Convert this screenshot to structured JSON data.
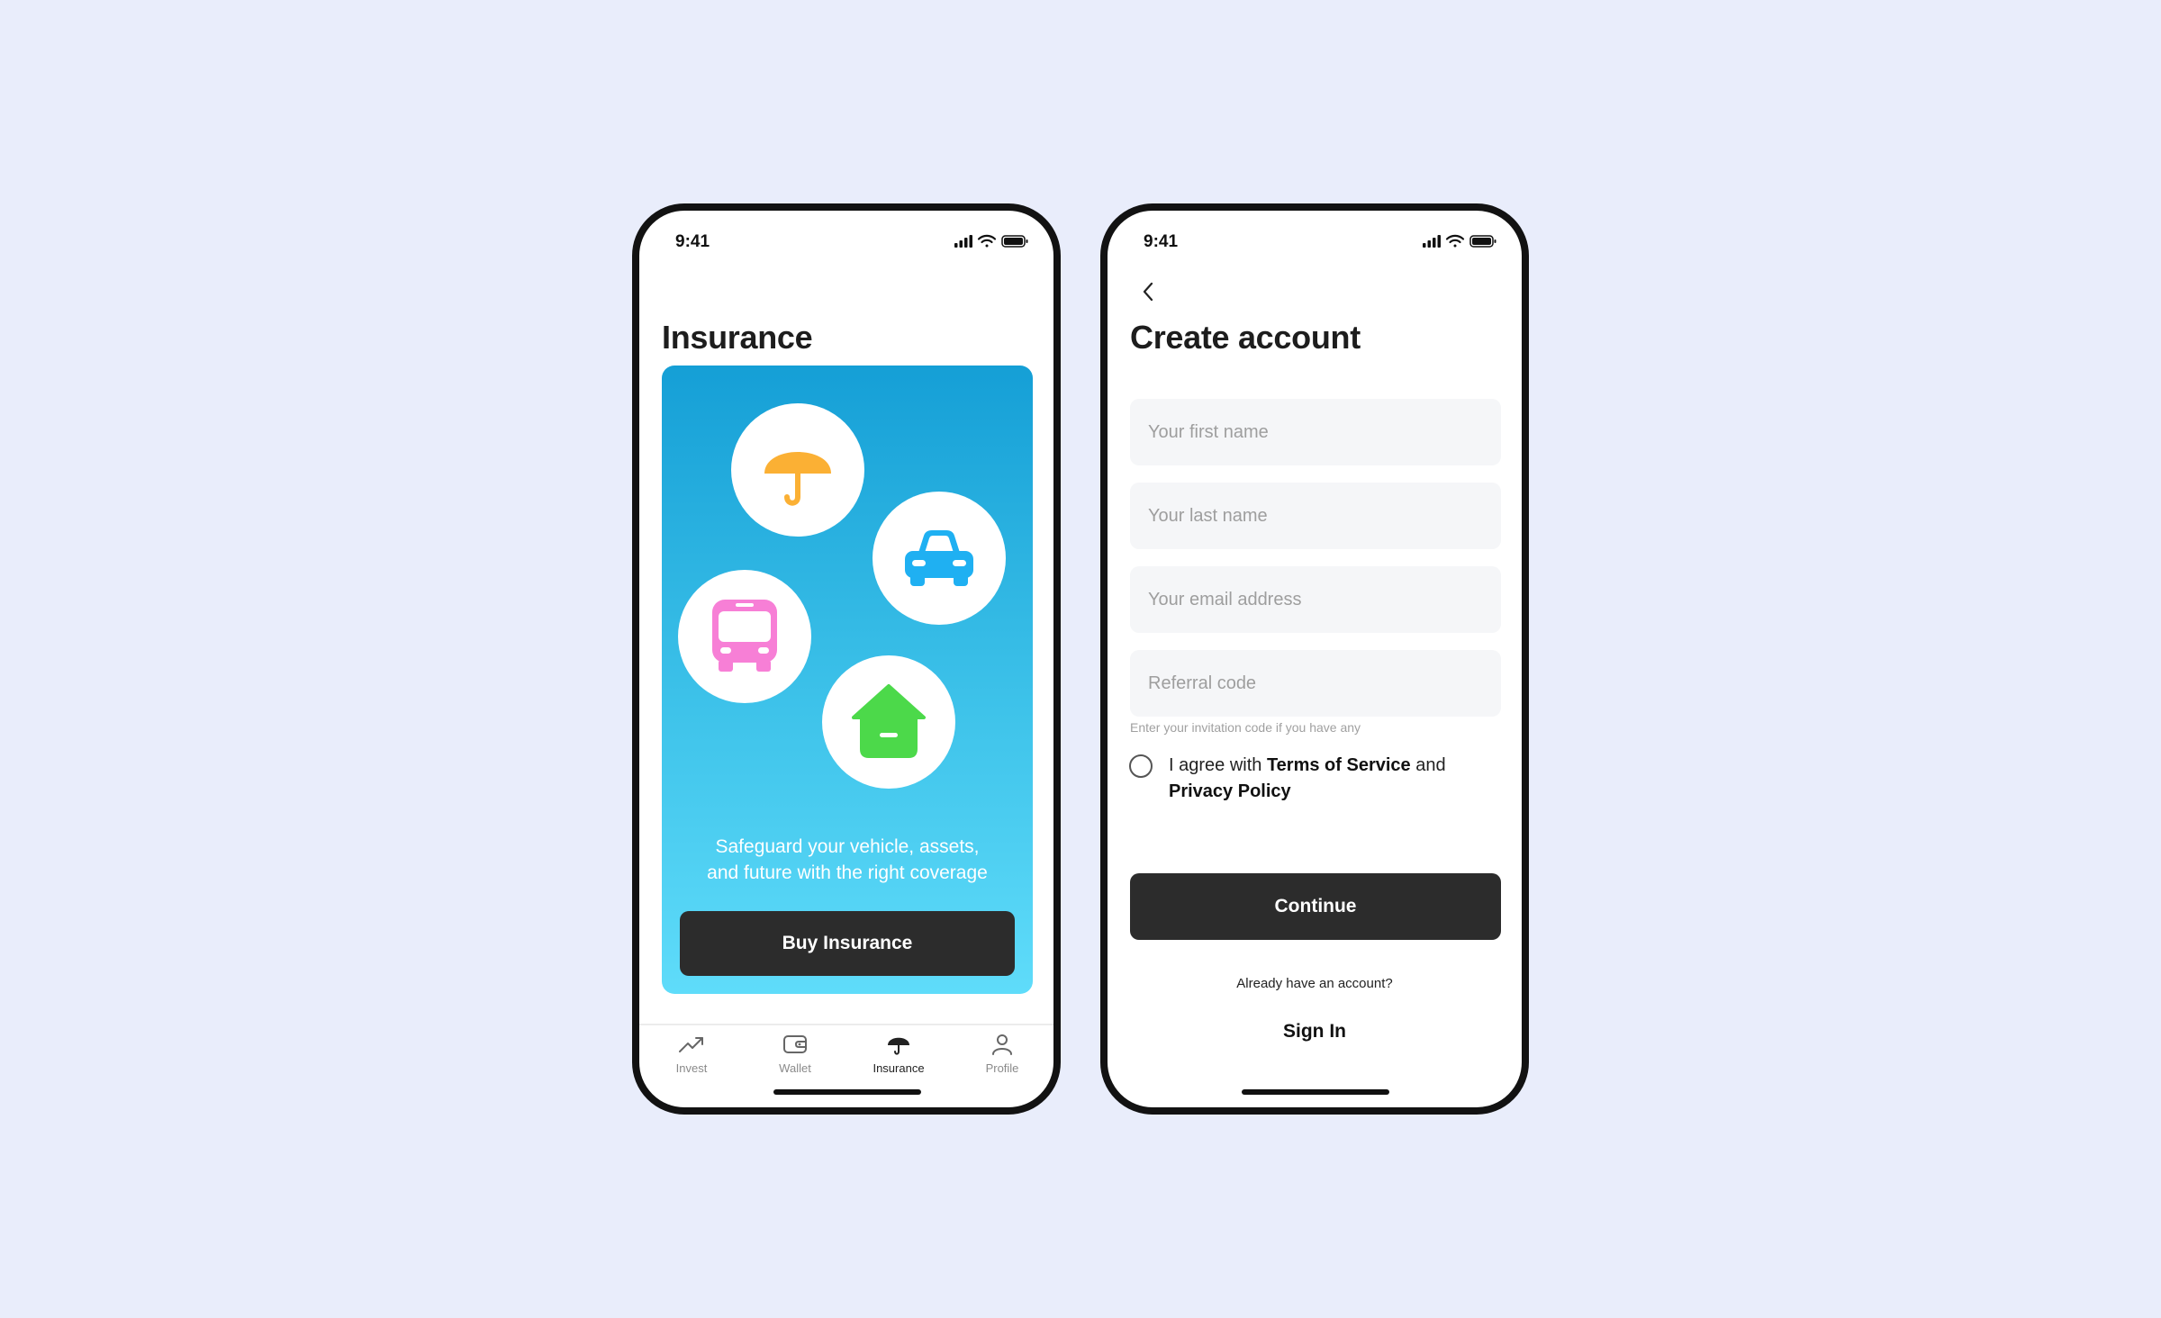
{
  "status_bar": {
    "time": "9:41"
  },
  "insurance_screen": {
    "title": "Insurance",
    "hero_icons": [
      "umbrella-icon",
      "car-icon",
      "bus-icon",
      "house-icon"
    ],
    "tagline_line1": "Safeguard your vehicle, assets,",
    "tagline_line2": "and future with the right coverage",
    "buy_button_label": "Buy Insurance",
    "tabs": [
      {
        "label": "Invest",
        "icon": "trending-up-icon",
        "active": false
      },
      {
        "label": "Wallet",
        "icon": "wallet-icon",
        "active": false
      },
      {
        "label": "Insurance",
        "icon": "umbrella-icon",
        "active": true
      },
      {
        "label": "Profile",
        "icon": "user-icon",
        "active": false
      }
    ]
  },
  "create_account_screen": {
    "title": "Create account",
    "first_name_placeholder": "Your first name",
    "last_name_placeholder": "Your last name",
    "email_placeholder": "Your email address",
    "referral_placeholder": "Referral code",
    "referral_helper": "Enter your invitation code if you have any",
    "agree_prefix": "I agree with ",
    "terms_link": "Terms of Service",
    "agree_middle": " and",
    "privacy_link": "Privacy Policy",
    "continue_label": "Continue",
    "already_text": "Already have an account?",
    "sign_in_label": "Sign In"
  },
  "colors": {
    "background": "#e9edfb",
    "button_dark": "#2c2c2c",
    "umbrella": "#fbb034",
    "car": "#1fb0f2",
    "bus": "#f77fd6",
    "house": "#4cd94a"
  }
}
